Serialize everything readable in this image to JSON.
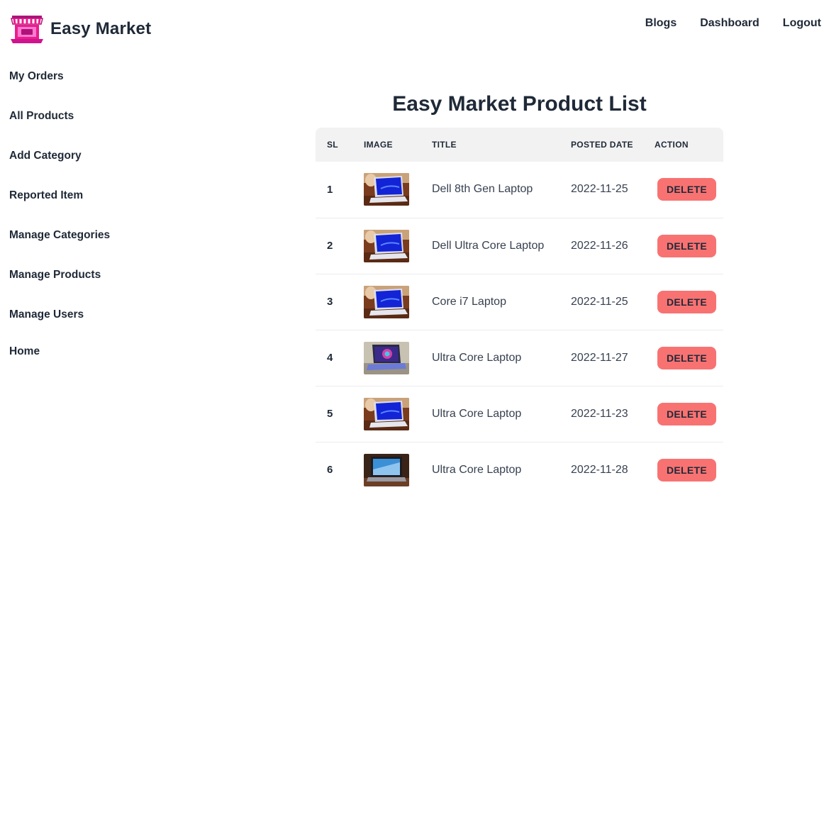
{
  "brand": {
    "name": "Easy Market",
    "logo": "storefront-laptop-logo"
  },
  "topnav": [
    {
      "label": "Blogs"
    },
    {
      "label": "Dashboard"
    },
    {
      "label": "Logout"
    }
  ],
  "sidebar": [
    {
      "label": "My Orders"
    },
    {
      "label": "All Products"
    },
    {
      "label": "Add Category"
    },
    {
      "label": "Reported Item"
    },
    {
      "label": "Manage Categories"
    },
    {
      "label": "Manage Products"
    },
    {
      "label": "Manage Users"
    },
    {
      "label": "Home"
    }
  ],
  "main": {
    "title": "Easy Market Product List",
    "columns": [
      "SL",
      "IMAGE",
      "TITLE",
      "POSTED DATE",
      "ACTION"
    ],
    "rows": [
      {
        "sl": "1",
        "title": "Dell 8th Gen Laptop",
        "date": "2022-11-25",
        "action": "DELETE",
        "image": "laptop-blue-screen"
      },
      {
        "sl": "2",
        "title": "Dell Ultra Core Laptop",
        "date": "2022-11-26",
        "action": "DELETE",
        "image": "laptop-blue-screen"
      },
      {
        "sl": "3",
        "title": "Core i7 Laptop",
        "date": "2022-11-25",
        "action": "DELETE",
        "image": "laptop-blue-screen"
      },
      {
        "sl": "4",
        "title": "Ultra Core Laptop",
        "date": "2022-11-27",
        "action": "DELETE",
        "image": "laptop-colorful-screen"
      },
      {
        "sl": "5",
        "title": "Ultra Core Laptop",
        "date": "2022-11-23",
        "action": "DELETE",
        "image": "laptop-blue-screen"
      },
      {
        "sl": "6",
        "title": "Ultra Core Laptop",
        "date": "2022-11-28",
        "action": "DELETE",
        "image": "laptop-dark-desk"
      }
    ]
  },
  "colors": {
    "accent": "#f87272",
    "logo": "#e91e8c",
    "header_bg": "#f2f2f2",
    "text": "#1f2937"
  }
}
